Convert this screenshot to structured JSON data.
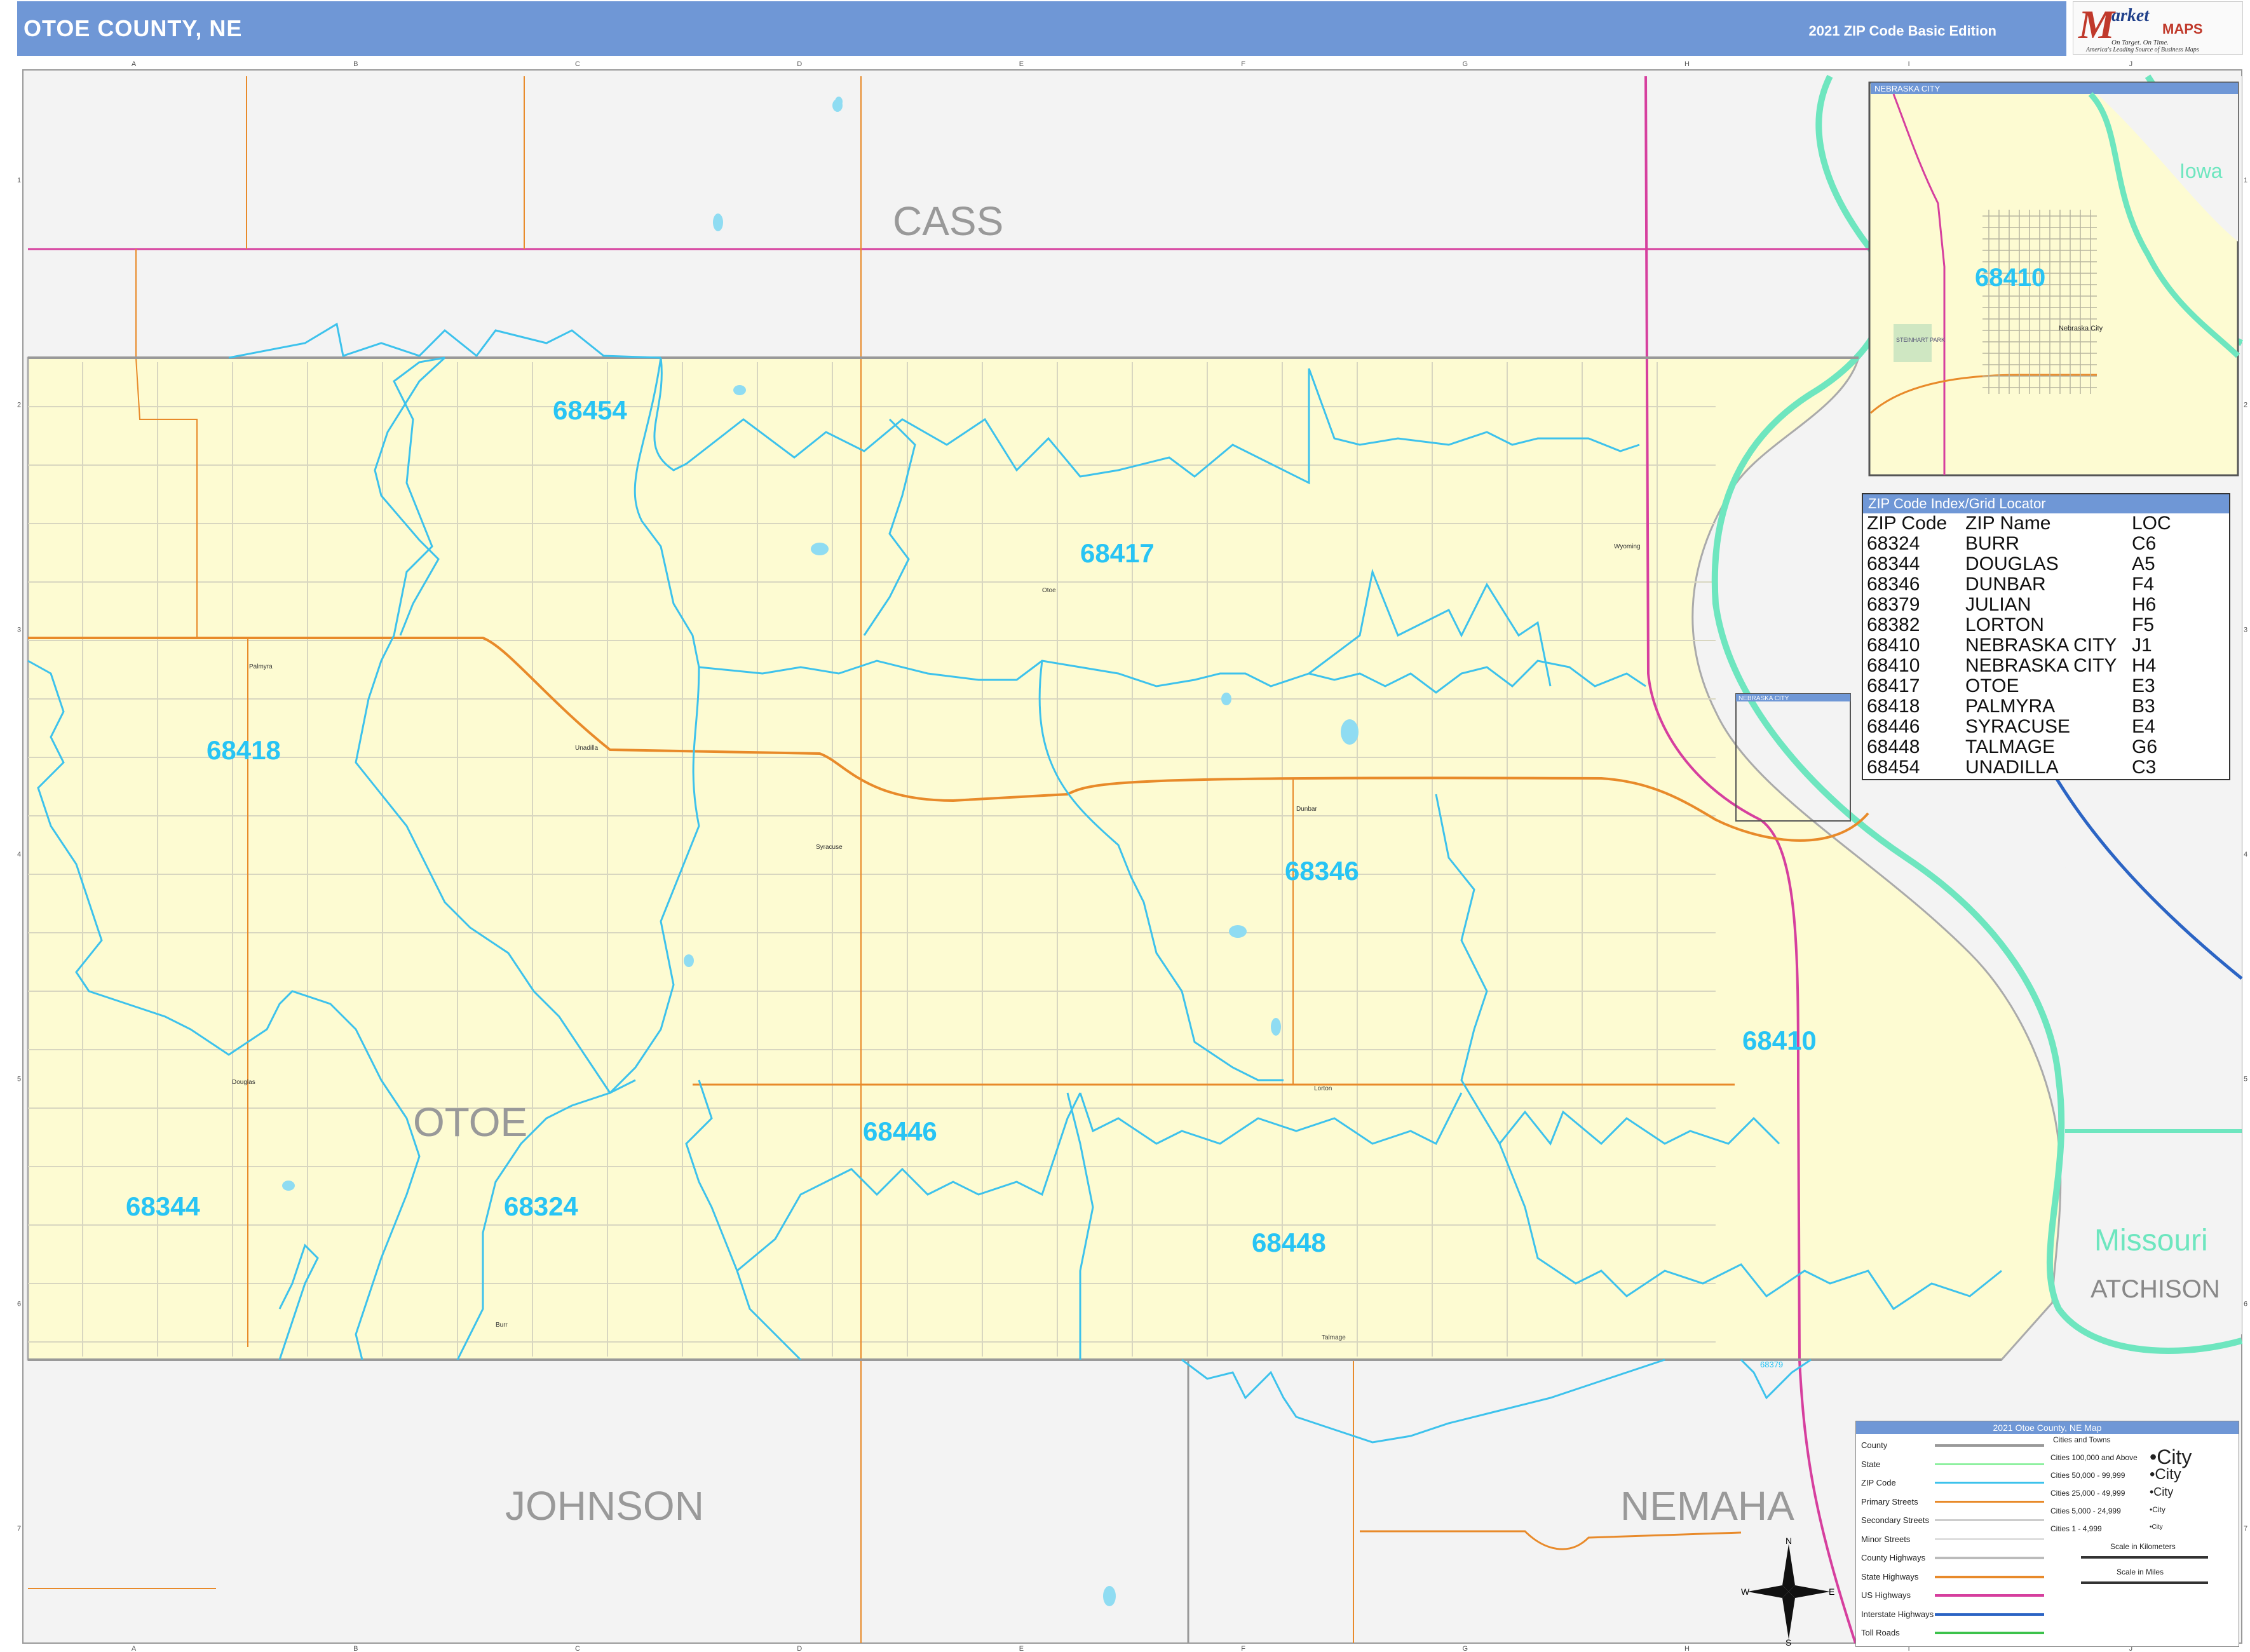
{
  "header": {
    "title": "OTOE COUNTY, NE",
    "edition": "2021 ZIP Code Basic Edition"
  },
  "logo": {
    "mark": "M",
    "line1": "arket",
    "line2": "MAPS",
    "tagline": "On Target. On Time.",
    "tagline2": "America's Leading Source of Business Maps"
  },
  "grid": {
    "columns": [
      "A",
      "B",
      "C",
      "D",
      "E",
      "F",
      "G",
      "H",
      "I",
      "J"
    ],
    "rows": [
      "1",
      "2",
      "3",
      "4",
      "5",
      "6",
      "7"
    ]
  },
  "map": {
    "counties": {
      "cass": "CASS",
      "otoe": "OTOE",
      "johnson": "JOHNSON",
      "nemaha": "NEMAHA",
      "atchison": "ATCHISON"
    },
    "state_labels": {
      "iowa": "Iowa",
      "missouri": "Missouri"
    },
    "zip_labels": {
      "z68454": "68454",
      "z68417": "68417",
      "z68418": "68418",
      "z68346": "68346",
      "z68410": "68410",
      "z68446": "68446",
      "z68344": "68344",
      "z68324": "68324",
      "z68448": "68448",
      "z68410_inset": "68410",
      "z68379": "68379"
    },
    "towns": {
      "palmyra": "Palmyra",
      "unadilla": "Unadilla",
      "syracuse": "Syracuse",
      "otoe": "Otoe",
      "dunbar": "Dunbar",
      "lorton": "Lorton",
      "douglas": "Douglas",
      "burr": "Burr",
      "talmage": "Talmage",
      "wyoming": "Wyoming",
      "nebraska_city": "Nebraska City",
      "steinhart": "STEINHART PARK"
    },
    "inset_title": "NEBRASKA CITY",
    "inset_box_label": "NEBRASKA CITY",
    "colors": {
      "county_fill": "#fdfbd2",
      "outside_fill": "#f3f3f3",
      "zip_boundary": "#3dc2ec",
      "zip_label": "#28c4f4",
      "primary_street": "#e88a2a",
      "us_highway": "#d63f9e",
      "river": "#6ee6bf",
      "interstate": "#2b64c4"
    }
  },
  "zip_index": {
    "title": "ZIP Code Index/Grid Locator",
    "headers": [
      "ZIP Code",
      "ZIP Name",
      "LOC"
    ],
    "rows": [
      [
        "68324",
        "BURR",
        "C6"
      ],
      [
        "68344",
        "DOUGLAS",
        "A5"
      ],
      [
        "68346",
        "DUNBAR",
        "F4"
      ],
      [
        "68379",
        "JULIAN",
        "H6"
      ],
      [
        "68382",
        "LORTON",
        "F5"
      ],
      [
        "68410",
        "NEBRASKA CITY",
        "J1"
      ],
      [
        "68410",
        "NEBRASKA CITY",
        "H4"
      ],
      [
        "68417",
        "OTOE",
        "E3"
      ],
      [
        "68418",
        "PALMYRA",
        "B3"
      ],
      [
        "68446",
        "SYRACUSE",
        "E4"
      ],
      [
        "68448",
        "TALMAGE",
        "G6"
      ],
      [
        "68454",
        "UNADILLA",
        "C3"
      ]
    ]
  },
  "legend": {
    "title": "2021 Otoe County, NE Map",
    "items": [
      "County",
      "State",
      "ZIP Code",
      "Primary Streets",
      "Secondary Streets",
      "Minor Streets",
      "County Highways",
      "State Highways",
      "US Highways",
      "Interstate Highways",
      "Toll Roads"
    ],
    "cities_header": "Cities and Towns",
    "city_tiers": [
      "Cities 100,000 and Above",
      "Cities 50,000 - 99,999",
      "Cities 25,000 - 49,999",
      "Cities 5,000 - 24,999",
      "Cities 1 - 4,999"
    ],
    "city_samples": [
      "•City",
      "•City",
      "•City",
      "•City",
      "•City"
    ],
    "scale_km": "Scale in Kilometers",
    "scale_mi": "Scale in Miles"
  },
  "compass": {
    "n": "N",
    "s": "S",
    "e": "E",
    "w": "W"
  }
}
